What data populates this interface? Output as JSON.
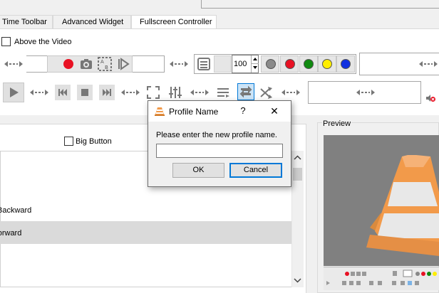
{
  "tabs": [
    {
      "label": "Time Toolbar"
    },
    {
      "label": "Advanced Widget"
    },
    {
      "label": "Fullscreen Controller"
    }
  ],
  "toolbar_options": {
    "above_video_label": "Above the Video",
    "above_video_checked": false,
    "big_button_label": "Big Button",
    "big_button_checked": false
  },
  "spin_value": "100",
  "color_buttons": [
    "gray",
    "red",
    "green",
    "yellow",
    "blue"
  ],
  "colors": {
    "record_red": "#e81123",
    "accent_blue": "#0078d7",
    "gray": "#8a8a8a",
    "red": "#e81123",
    "green": "#108a10",
    "yellow": "#ffee00",
    "blue": "#1030e0",
    "cone_orange": "#f29a4a"
  },
  "list": {
    "items": [
      {
        "label": "Backward"
      },
      {
        "label": "Forward"
      }
    ]
  },
  "preview": {
    "label": "Preview"
  },
  "dialog": {
    "title": "Profile Name",
    "help_glyph": "?",
    "close_glyph": "✕",
    "prompt": "Please enter the new profile name.",
    "input_value": "",
    "ok_label": "OK",
    "cancel_label": "Cancel"
  }
}
